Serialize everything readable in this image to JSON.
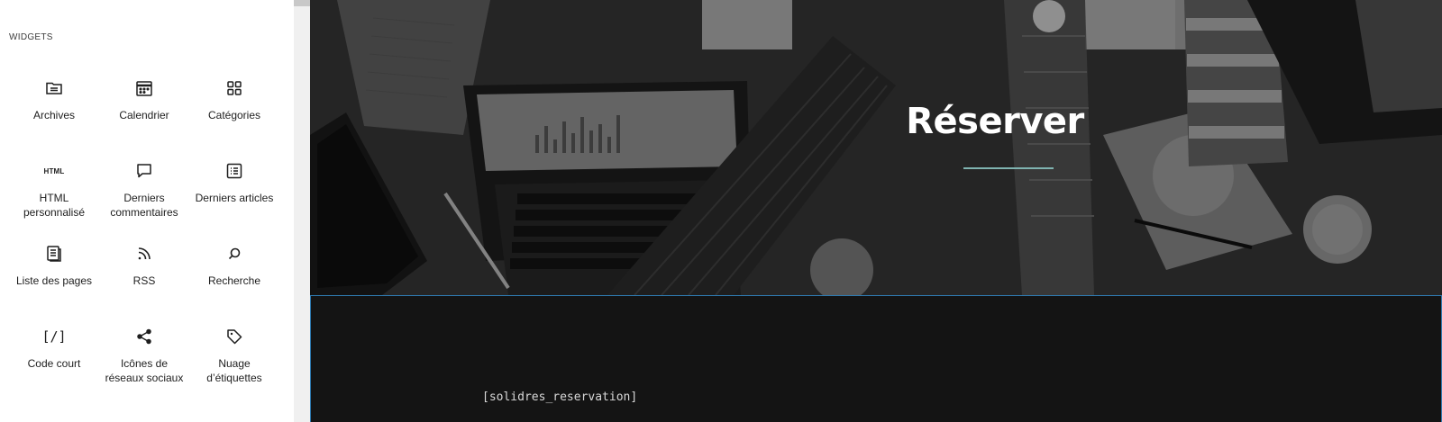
{
  "panel": {
    "section_title": "WIDGETS",
    "blocks": [
      {
        "label": "Archives",
        "icon": "archives-icon"
      },
      {
        "label": "Calendrier",
        "icon": "calendar-icon"
      },
      {
        "label": "Catégories",
        "icon": "categories-icon"
      },
      {
        "label": "HTML personnalisé",
        "icon": "html-icon",
        "icon_text": "HTML"
      },
      {
        "label": "Derniers commentaires",
        "icon": "comment-icon"
      },
      {
        "label": "Derniers articles",
        "icon": "post-list-icon"
      },
      {
        "label": "Liste des pages",
        "icon": "pages-icon"
      },
      {
        "label": "RSS",
        "icon": "rss-icon"
      },
      {
        "label": "Recherche",
        "icon": "search-icon"
      },
      {
        "label": "Code court",
        "icon": "shortcode-icon",
        "icon_text": "[/]"
      },
      {
        "label": "Icônes de réseaux sociaux",
        "icon": "share-icon"
      },
      {
        "label": "Nuage d’étiquettes",
        "icon": "tag-icon"
      }
    ]
  },
  "canvas": {
    "hero_title": "Réserver",
    "shortcode_text": "[solidres_reservation]"
  },
  "colors": {
    "hero_accent": "#7fb3b0",
    "selection_border": "#2f7ab0",
    "canvas_bg": "#141414"
  }
}
